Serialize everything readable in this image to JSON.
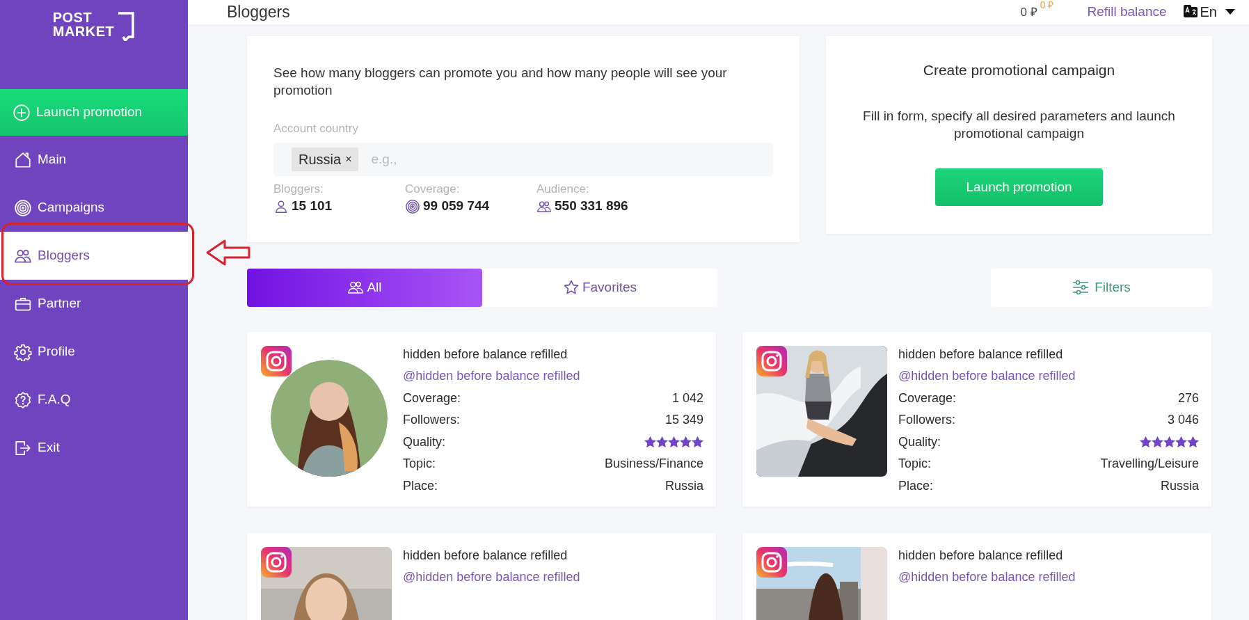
{
  "logo": {
    "lines": [
      "POST",
      "MARKET"
    ]
  },
  "sidebar": {
    "cta": {
      "label": "Launch promotion"
    },
    "items": [
      {
        "label": "Main",
        "selected": false
      },
      {
        "label": "Campaigns",
        "selected": false
      },
      {
        "label": "Bloggers",
        "selected": true
      },
      {
        "label": "Partner",
        "selected": false
      },
      {
        "label": "Profile",
        "selected": false
      },
      {
        "label": "F.A.Q",
        "selected": false
      },
      {
        "label": "Exit",
        "selected": false
      }
    ]
  },
  "header": {
    "title": "Bloggers",
    "balance": "0 ₽",
    "bonus": "0 ₽",
    "refill": "Refill balance",
    "language": "En"
  },
  "estimate": {
    "description": "See how many bloggers can promote you and how many people will see your promotion",
    "country_label": "Account country",
    "tags": [
      {
        "label": "Russia",
        "remove": "×"
      }
    ],
    "placeholder": "e.g.,",
    "stats": [
      {
        "label": "Bloggers:",
        "value": "15 101"
      },
      {
        "label": "Coverage:",
        "value": "99 059 744"
      },
      {
        "label": "Audience:",
        "value": "550 331 896"
      }
    ]
  },
  "campaign": {
    "title": "Create promotional campaign",
    "text": "Fill in form, specify all desired parameters and launch promotional campaign",
    "button": "Launch promotion"
  },
  "tabs": [
    {
      "label": "All",
      "selected": true
    },
    {
      "label": "Favorites",
      "selected": false
    }
  ],
  "filters": {
    "label": "Filters"
  },
  "bloggers": [
    {
      "name": "hidden before balance refilled",
      "handle": "@hidden before balance refilled",
      "fields": [
        {
          "kind": "text",
          "label": "Coverage:",
          "value": "1 042"
        },
        {
          "kind": "text",
          "label": "Followers:",
          "value": "15 349"
        },
        {
          "kind": "stars",
          "label": "Quality:",
          "stars": 5
        },
        {
          "kind": "text",
          "label": "Topic:",
          "value": "Business/Finance"
        },
        {
          "kind": "text",
          "label": "Place:",
          "value": "Russia"
        }
      ]
    },
    {
      "name": "hidden before balance refilled",
      "handle": "@hidden before balance refilled",
      "fields": [
        {
          "kind": "text",
          "label": "Coverage:",
          "value": "276"
        },
        {
          "kind": "text",
          "label": "Followers:",
          "value": "3 046"
        },
        {
          "kind": "stars",
          "label": "Quality:",
          "stars": 5
        },
        {
          "kind": "text",
          "label": "Topic:",
          "value": "Travelling/Leisure"
        },
        {
          "kind": "text",
          "label": "Place:",
          "value": "Russia"
        }
      ]
    },
    {
      "name": "hidden before balance refilled",
      "handle": "@hidden before balance refilled"
    },
    {
      "name": "hidden before balance refilled",
      "handle": "@hidden before balance refilled"
    }
  ]
}
